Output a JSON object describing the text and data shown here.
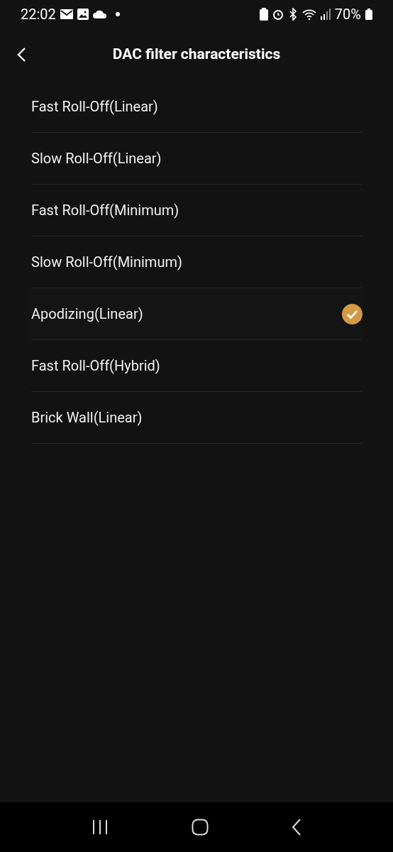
{
  "status_bar": {
    "time": "22:02",
    "battery": "70%"
  },
  "header": {
    "title": "DAC filter characteristics"
  },
  "options": [
    {
      "label": "Fast Roll-Off(Linear)",
      "selected": false
    },
    {
      "label": "Slow Roll-Off(Linear)",
      "selected": false
    },
    {
      "label": "Fast Roll-Off(Minimum)",
      "selected": false
    },
    {
      "label": "Slow Roll-Off(Minimum)",
      "selected": false
    },
    {
      "label": "Apodizing(Linear)",
      "selected": true
    },
    {
      "label": "Fast Roll-Off(Hybrid)",
      "selected": false
    },
    {
      "label": "Brick Wall(Linear)",
      "selected": false
    }
  ]
}
